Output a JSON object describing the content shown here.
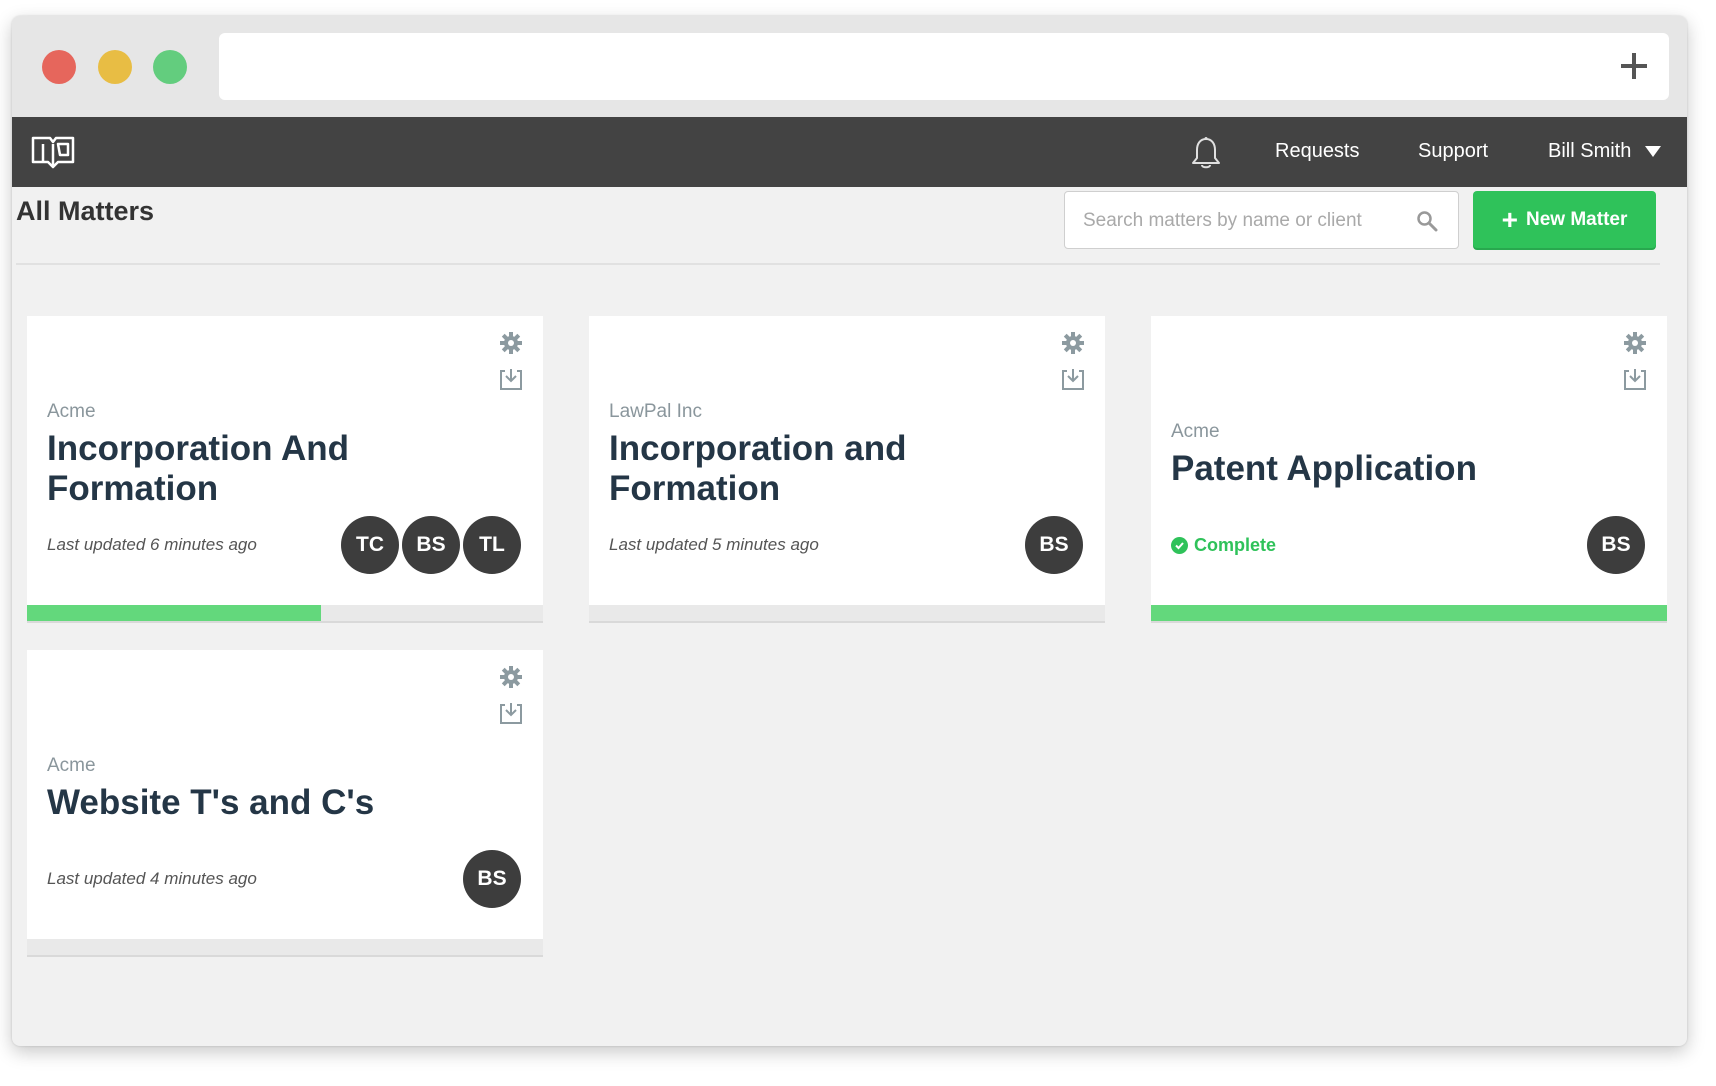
{
  "navbar": {
    "requests": "Requests",
    "support": "Support",
    "user_name": "Bill Smith"
  },
  "page": {
    "title": "All Matters"
  },
  "search": {
    "placeholder": "Search matters by name or client"
  },
  "new_matter_button": {
    "label": "New Matter"
  },
  "colors": {
    "accent_green": "#2fc25a",
    "navbar": "#434343",
    "progress": "#63d87c"
  },
  "matters": [
    {
      "client": "Acme",
      "title": "Incorporation And Formation",
      "updated": "Last updated 6 minutes ago",
      "status": "",
      "avatars": [
        "TC",
        "BS",
        "TL"
      ],
      "progress": 0.57
    },
    {
      "client": "LawPal Inc",
      "title": "Incorporation and Formation",
      "updated": "Last updated 5 minutes ago",
      "status": "",
      "avatars": [
        "BS"
      ],
      "progress": 0
    },
    {
      "client": "Acme",
      "title": "Patent Application",
      "updated": "",
      "status": "Complete",
      "avatars": [
        "BS"
      ],
      "progress": 1
    },
    {
      "client": "Acme",
      "title": "Website T's and C's",
      "updated": "Last updated 4 minutes ago",
      "status": "",
      "avatars": [
        "BS"
      ],
      "progress": 0
    }
  ]
}
